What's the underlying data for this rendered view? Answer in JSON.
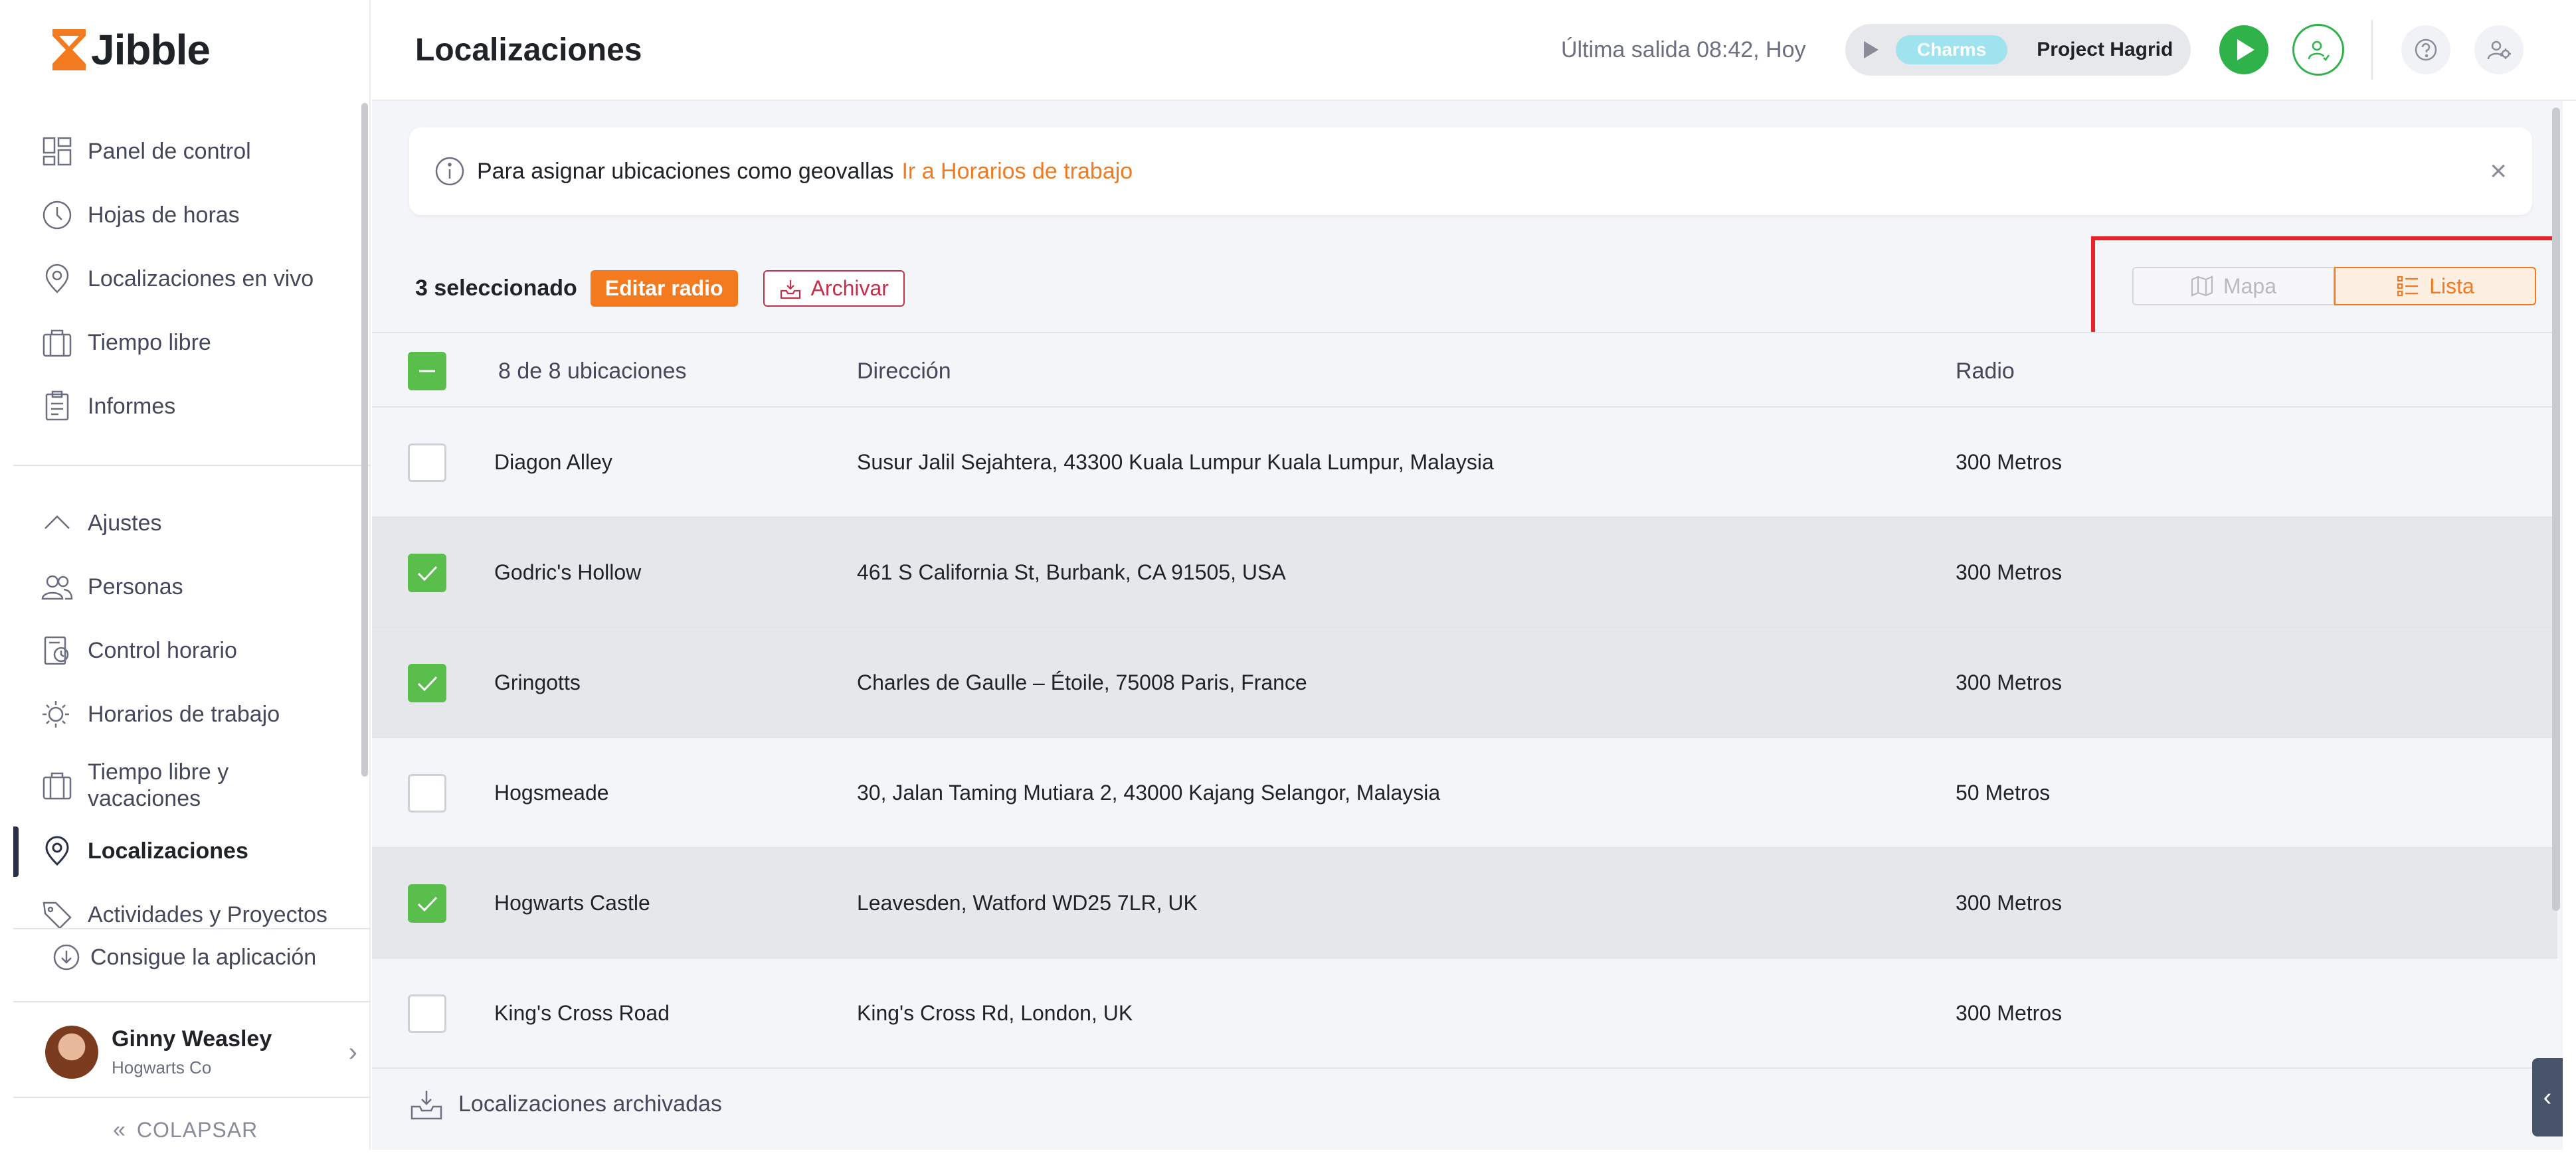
{
  "app": {
    "brand": "Jibble",
    "brand_color": "#f47a20"
  },
  "sidebar": {
    "items": [
      {
        "label": "Panel de control",
        "icon": "dashboard-icon"
      },
      {
        "label": "Hojas de horas",
        "icon": "clock-icon"
      },
      {
        "label": "Localizaciones en vivo",
        "icon": "map-pin-icon"
      },
      {
        "label": "Tiempo libre",
        "icon": "suitcase-icon"
      },
      {
        "label": "Informes",
        "icon": "clipboard-icon"
      }
    ],
    "settings_label": "Ajustes",
    "settings_items": [
      {
        "label": "Personas",
        "icon": "people-icon"
      },
      {
        "label": "Control horario",
        "icon": "time-tracking-icon"
      },
      {
        "label": "Horarios de trabajo",
        "icon": "work-schedule-icon"
      },
      {
        "label": "Tiempo libre y vacaciones",
        "icon": "suitcase-icon"
      },
      {
        "label": "Localizaciones",
        "icon": "map-pin-icon",
        "active": true
      },
      {
        "label": "Actividades y Proyectos",
        "icon": "tag-icon"
      }
    ],
    "get_app": "Consigue la aplicación",
    "user": {
      "name": "Ginny Weasley",
      "org": "Hogwarts Co"
    },
    "collapse": "COLAPSAR"
  },
  "topbar": {
    "title": "Localizaciones",
    "last_out": "Última salida 08:42, Hoy",
    "activity_tag": "Charms",
    "project": "Project Hagrid"
  },
  "banner": {
    "text": "Para asignar ubicaciones como geovallas",
    "link": "Ir a Horarios de trabajo"
  },
  "toolbar": {
    "selected": "3 seleccionado",
    "edit_radius": "Editar radio",
    "archive": "Archivar",
    "view_map": "Mapa",
    "view_list": "Lista",
    "active_view": "Lista"
  },
  "table": {
    "headers": {
      "name": "8 de 8 ubicaciones",
      "address": "Dirección",
      "radius": "Radio"
    },
    "rows": [
      {
        "name": "Diagon Alley",
        "address": "Susur Jalil Sejahtera, 43300 Kuala Lumpur Kuala Lumpur, Malaysia",
        "radius": "300 Metros",
        "checked": false
      },
      {
        "name": "Godric's Hollow",
        "address": "461 S California St, Burbank, CA 91505, USA",
        "radius": "300 Metros",
        "checked": true
      },
      {
        "name": "Gringotts",
        "address": "Charles de Gaulle – Étoile, 75008 Paris, France",
        "radius": "300 Metros",
        "checked": true
      },
      {
        "name": "Hogsmeade",
        "address": "30, Jalan Taming Mutiara 2, 43000 Kajang Selangor, Malaysia",
        "radius": "50 Metros",
        "checked": false
      },
      {
        "name": "Hogwarts Castle",
        "address": "Leavesden, Watford WD25 7LR, UK",
        "radius": "300 Metros",
        "checked": true
      },
      {
        "name": "King's Cross Road",
        "address": "King's Cross Rd, London, UK",
        "radius": "300 Metros",
        "checked": false
      }
    ]
  },
  "footer": {
    "archived": "Localizaciones archivadas"
  }
}
